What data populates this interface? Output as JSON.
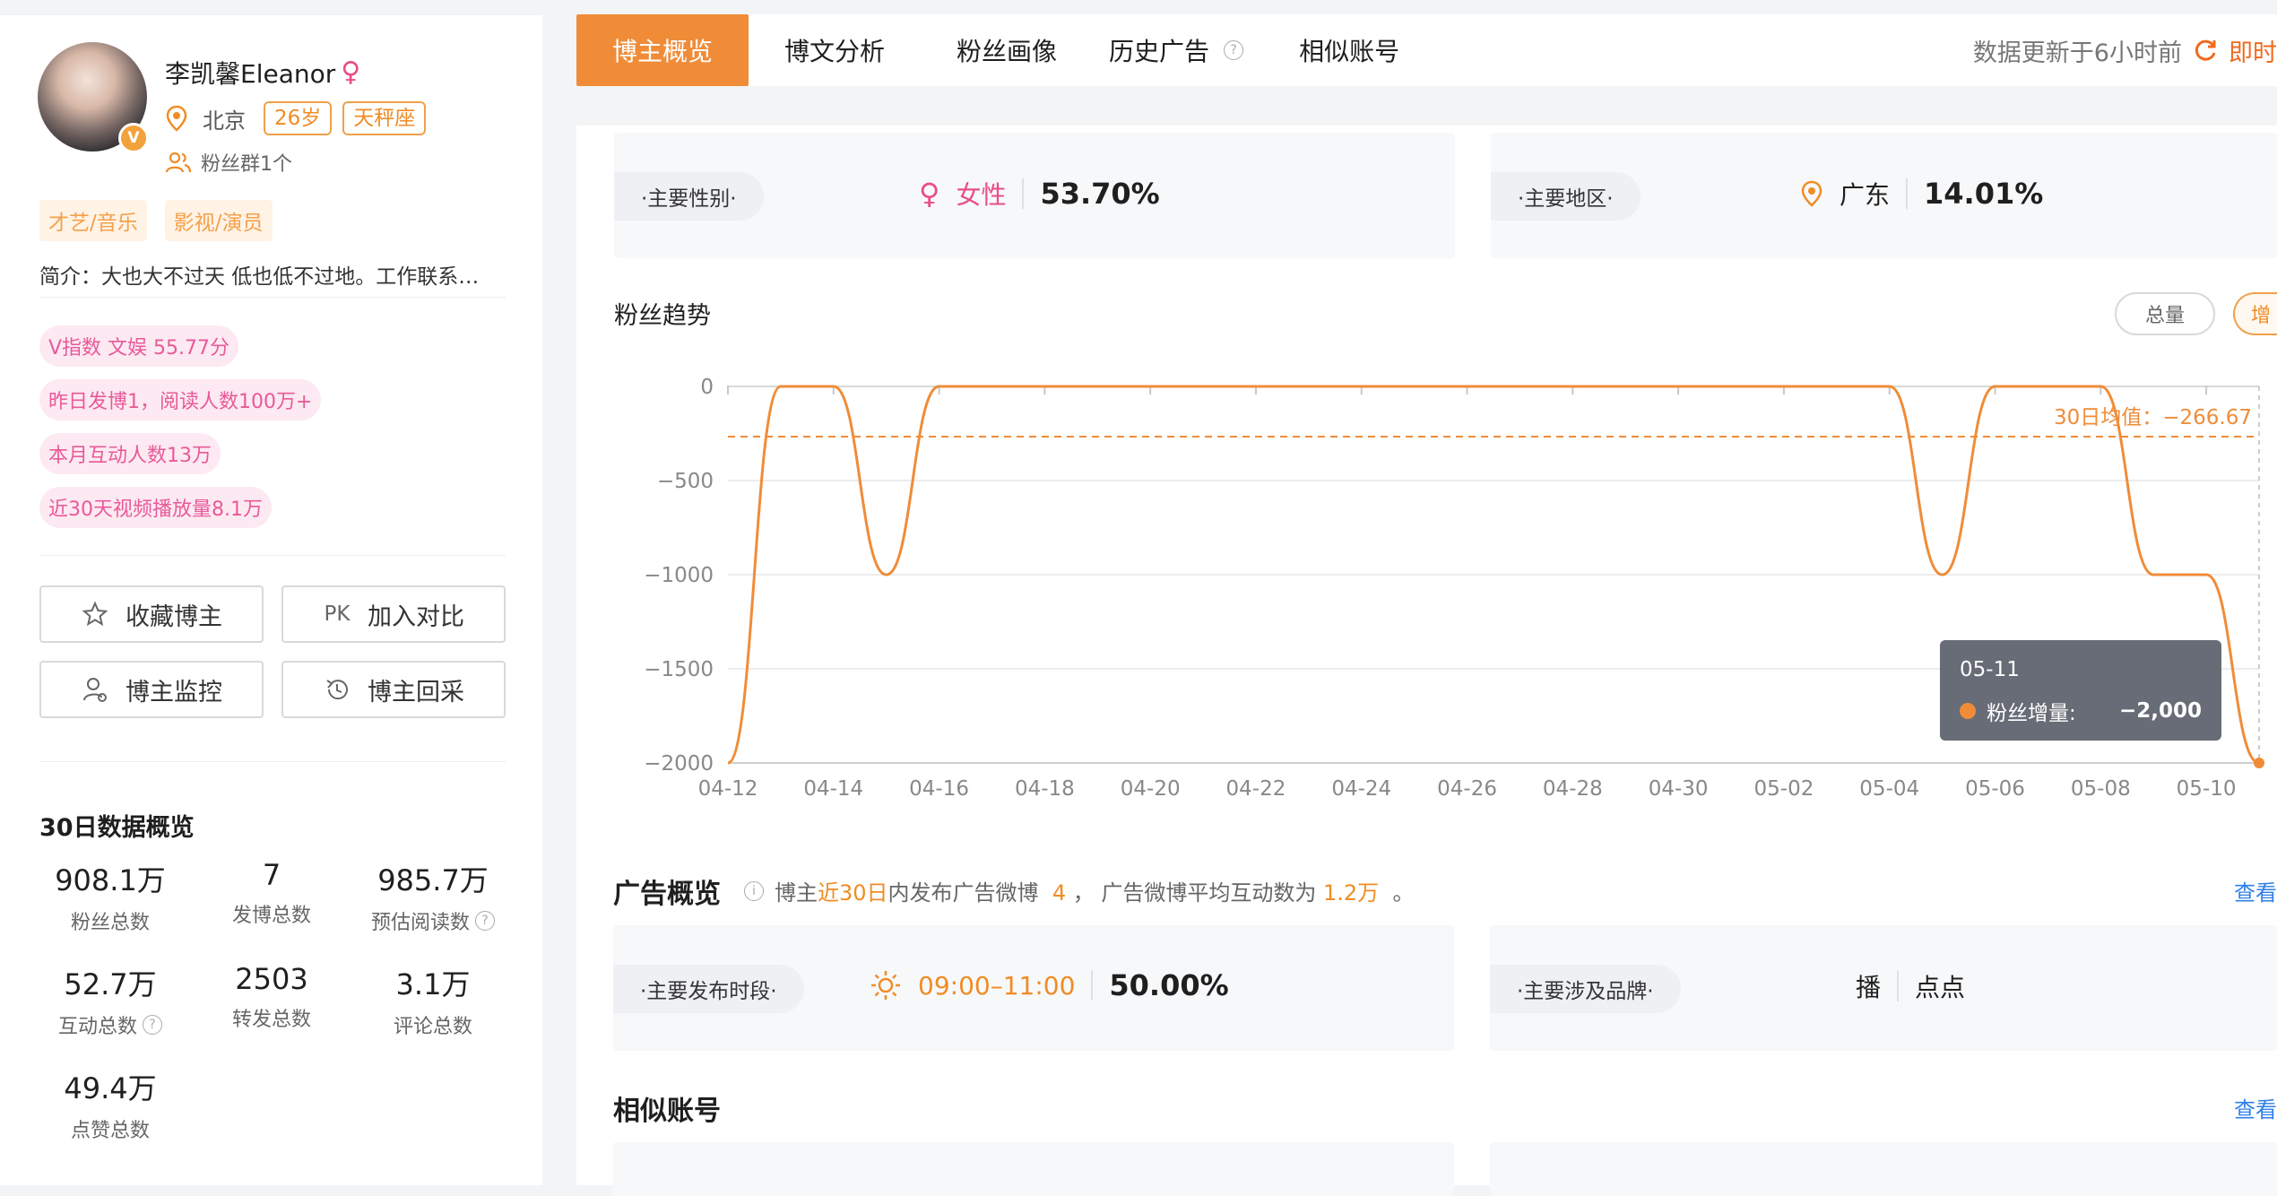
{
  "profile": {
    "name": "李凯馨Eleanor",
    "gender_symbol": "♀",
    "verified_badge": "V",
    "location": "北京",
    "age": "26岁",
    "zodiac": "天秤座",
    "fan_group": "粉丝群1个",
    "categories": [
      "才艺/音乐",
      "影视/演员"
    ],
    "bio": "简介：大也大不过天 低也低不过地。工作联系…",
    "pills": [
      "V指数 文娱 55.77分",
      "昨日发博1，阅读人数100万+",
      "本月互动人数13万",
      "近30天视频播放量8.1万"
    ],
    "buttons": {
      "favorite": "收藏博主",
      "compare": "加入对比",
      "compare_icon": "PK",
      "monitor": "博主监控",
      "backfill": "博主回采"
    }
  },
  "overview": {
    "title": "30日数据概览",
    "stats": [
      {
        "value": "908.1万",
        "label": "粉丝总数"
      },
      {
        "value": "7",
        "label": "发博总数"
      },
      {
        "value": "985.7万",
        "label": "预估阅读数",
        "help": true
      },
      {
        "value": "52.7万",
        "label": "互动总数",
        "help": true
      },
      {
        "value": "2503",
        "label": "转发总数"
      },
      {
        "value": "3.1万",
        "label": "评论总数"
      },
      {
        "value": "49.4万",
        "label": "点赞总数"
      }
    ]
  },
  "tabs": [
    {
      "label": "博主概览",
      "active": true
    },
    {
      "label": "博文分析"
    },
    {
      "label": "粉丝画像"
    },
    {
      "label": "历史广告",
      "help": true
    },
    {
      "label": "相似账号"
    }
  ],
  "update": {
    "text": "数据更新于6小时前",
    "action": "即时"
  },
  "gender_card": {
    "label": "·主要性别·",
    "value": "女性",
    "percent": "53.70%"
  },
  "region_card": {
    "label": "·主要地区·",
    "value": "广东",
    "percent": "14.01%"
  },
  "trend": {
    "title": "粉丝趋势",
    "toggle_total": "总量",
    "toggle_increase": "增"
  },
  "chart_data": {
    "type": "line",
    "x": [
      "04-12",
      "04-13",
      "04-14",
      "04-15",
      "04-16",
      "04-17",
      "04-18",
      "04-19",
      "04-20",
      "04-21",
      "04-22",
      "04-23",
      "04-24",
      "04-25",
      "04-26",
      "04-27",
      "04-28",
      "04-29",
      "04-30",
      "05-01",
      "05-02",
      "05-03",
      "05-04",
      "05-05",
      "05-06",
      "05-07",
      "05-08",
      "05-09",
      "05-10",
      "05-11"
    ],
    "x_tick_labels": [
      "04-12",
      "04-14",
      "04-16",
      "04-18",
      "04-20",
      "04-22",
      "04-24",
      "04-26",
      "04-28",
      "04-30",
      "05-02",
      "05-04",
      "05-06",
      "05-08",
      "05-10"
    ],
    "series": [
      {
        "name": "粉丝增量",
        "values": [
          -2000,
          0,
          0,
          -1000,
          0,
          0,
          0,
          0,
          0,
          0,
          0,
          0,
          0,
          0,
          0,
          0,
          0,
          0,
          0,
          0,
          0,
          0,
          0,
          -1000,
          0,
          0,
          0,
          -1000,
          -1000,
          -2000
        ]
      }
    ],
    "ylim": [
      -2000,
      0
    ],
    "y_ticks": [
      "0",
      "−500",
      "−1000",
      "−1500",
      "−2000"
    ],
    "y_tick_values": [
      0,
      -500,
      -1000,
      -1500,
      -2000
    ],
    "average": {
      "label": "30日均值：−266.67",
      "value": -266.67
    },
    "tooltip": {
      "date": "05-11",
      "series": "粉丝增量:",
      "value": "−2,000"
    },
    "color": "#f08c38",
    "grid": true
  },
  "ads": {
    "title": "广告概览",
    "info_prefix": "博主",
    "info_highlight1": "近30日",
    "info_mid1": "内发布广告微博",
    "info_count": "4",
    "info_mid2": "，  广告微博平均互动数为",
    "info_avg": "1.2万",
    "info_suffix": "。",
    "more": "查看",
    "time_card": {
      "label": "·主要发布时段·",
      "value": "09:00–11:00",
      "percent": "50.00%"
    },
    "brand_card": {
      "label": "·主要涉及品牌·",
      "brands": [
        "播",
        "点点"
      ]
    }
  },
  "similar": {
    "title": "相似账号",
    "more": "查看"
  }
}
